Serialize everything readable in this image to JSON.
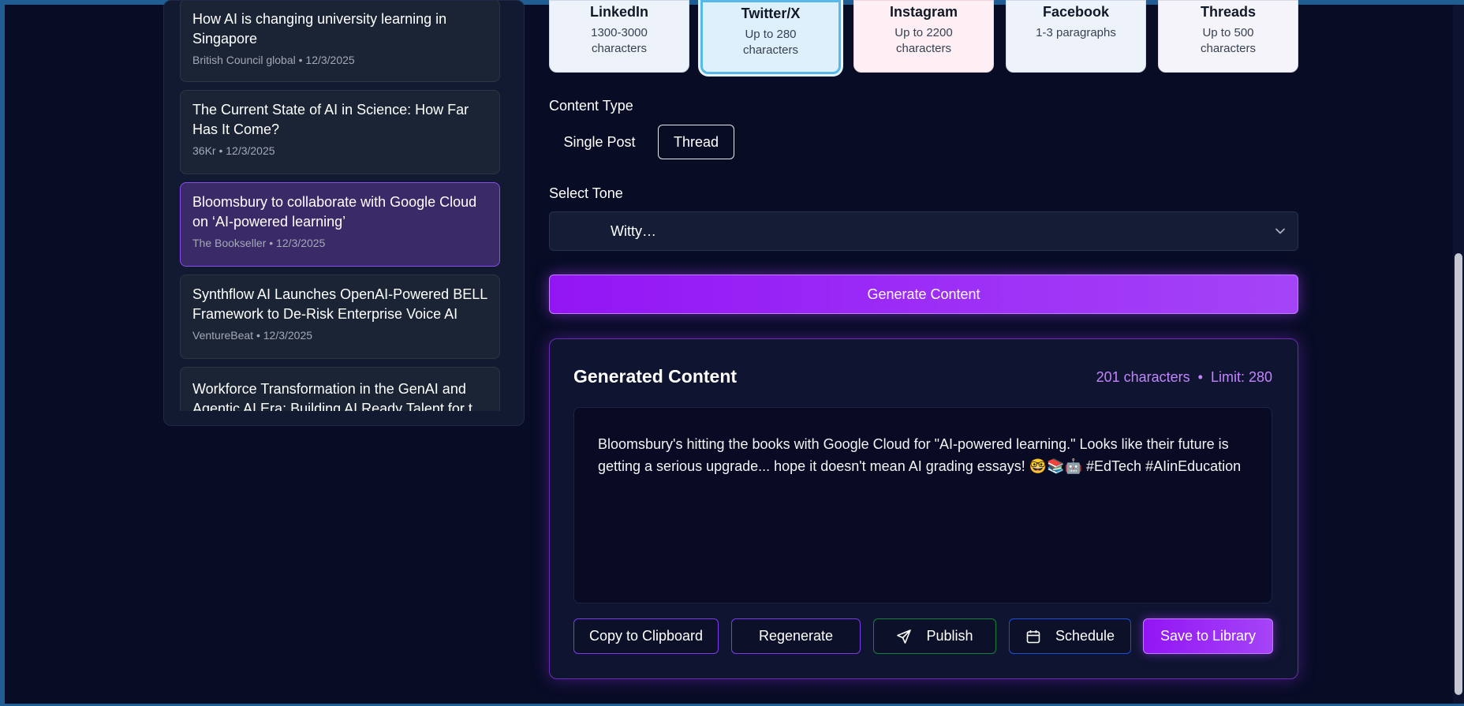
{
  "news": {
    "items": [
      {
        "title": "How AI is changing university learning in Singapore",
        "meta": "British Council global • 12/3/2025"
      },
      {
        "title": "The Current State of AI in Science: How Far Has It Come?",
        "meta": "36Kr • 12/3/2025"
      },
      {
        "title": "Bloomsbury to collaborate with Google Cloud on ‘AI-powered learning’",
        "meta": "The Bookseller • 12/3/2025"
      },
      {
        "title": "Synthflow AI Launches OpenAI-Powered BELL Framework to De-Risk Enterprise Voice AI",
        "meta": "VentureBeat • 12/3/2025"
      },
      {
        "title": "Workforce Transformation in the GenAI and Agentic AI Era: Building AI Ready Talent for t",
        "meta": ""
      }
    ]
  },
  "platforms": [
    {
      "name": "LinkedIn",
      "limit": "1300-3000 characters"
    },
    {
      "name": "Twitter/X",
      "limit": "Up to 280 characters"
    },
    {
      "name": "Instagram",
      "limit": "Up to 2200 characters"
    },
    {
      "name": "Facebook",
      "limit": "1-3 paragraphs"
    },
    {
      "name": "Threads",
      "limit": "Up to 500 characters"
    }
  ],
  "content_type": {
    "label": "Content Type",
    "options": [
      "Single Post",
      "Thread"
    ],
    "selected": "Thread"
  },
  "tone": {
    "label": "Select Tone",
    "value": "Witty…"
  },
  "generate_label": "Generate Content",
  "generated": {
    "title": "Generated Content",
    "count": "201 characters  •  Limit: 280",
    "text": "Bloomsbury's hitting the books with Google Cloud for \"AI-powered learning.\" Looks like their future is getting a serious upgrade... hope it doesn't mean AI grading essays! 🤓📚🤖 #EdTech #AIinEducation"
  },
  "actions": {
    "copy": "Copy to Clipboard",
    "regenerate": "Regenerate",
    "publish": "Publish",
    "schedule": "Schedule",
    "save": "Save to Library"
  },
  "colors": {
    "accent": "#9315f5",
    "background": "#080c25",
    "selected_item": "#3a2a68",
    "count_text": "#c384ff",
    "publish_border": "#15803d",
    "schedule_border": "#1d4ed8"
  }
}
